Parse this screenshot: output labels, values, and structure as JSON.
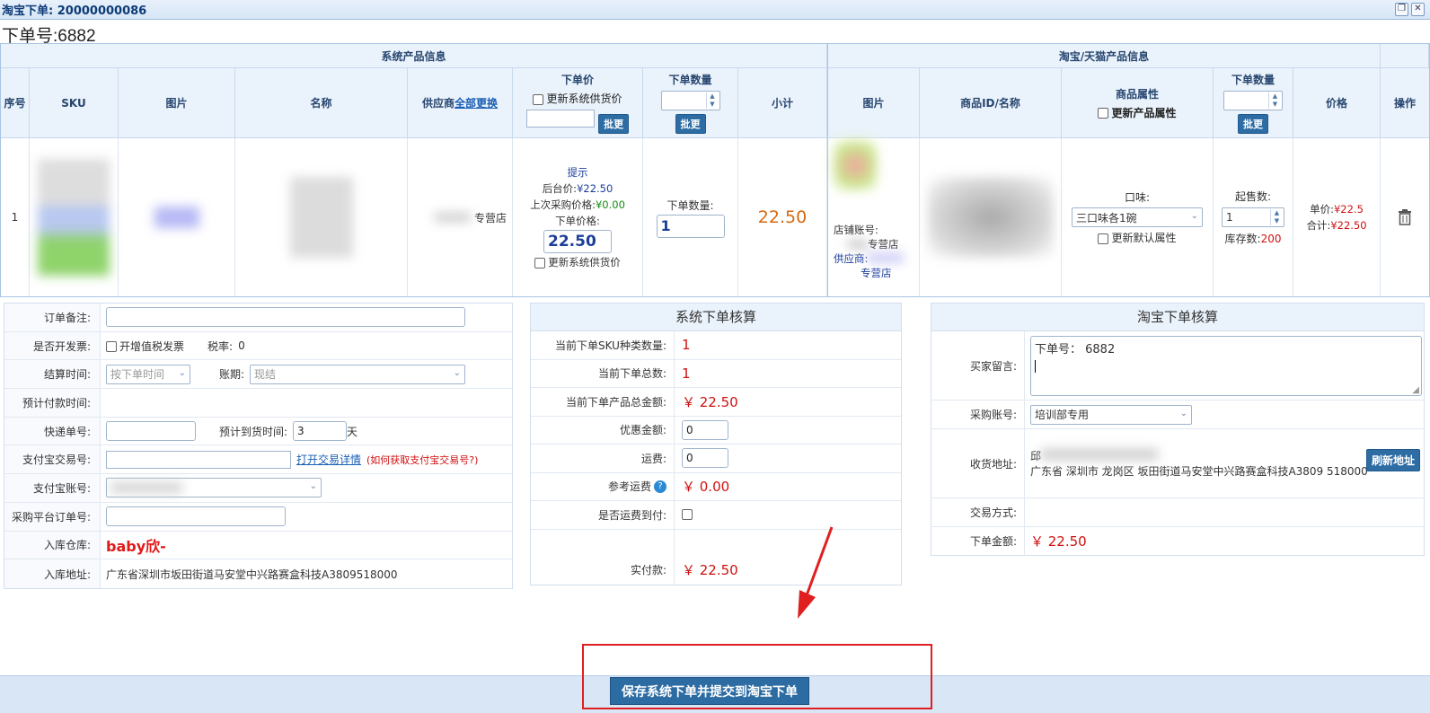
{
  "window": {
    "title": "淘宝下单: 20000000086",
    "order_label": "下单号:6882"
  },
  "header": {
    "sys_group": "系统产品信息",
    "tb_group": "淘宝/天猫产品信息",
    "col_no": "序号",
    "col_sku": "SKU",
    "col_img": "图片",
    "col_name": "名称",
    "col_supplier": "供应商",
    "col_supplier_link": "全部更换",
    "col_price": "下单价",
    "col_price_chk": "更新系统供货价",
    "col_qty": "下单数量",
    "col_subtotal": "小计",
    "col_tb_img": "图片",
    "col_tb_id": "商品ID/名称",
    "col_attr": "商品属性",
    "col_attr_chk": "更新产品属性",
    "col_tb_qty": "下单数量",
    "col_tb_price": "价格",
    "col_op": "操作",
    "batch": "批更"
  },
  "row": {
    "no": "1",
    "supplier": "专营店",
    "hint": "提示",
    "back_price_label": "后台价:",
    "back_price": "¥22.50",
    "last_price_label": "上次采购价格:",
    "last_price": "¥0.00",
    "order_price_label": "下单价格:",
    "order_price": "22.50",
    "update_chk": "更新系统供货价",
    "qty_label": "下单数量:",
    "qty": "1",
    "subtotal": "22.50",
    "shop_label": "店铺账号:",
    "shop_name": "专营店",
    "supplier_label": "供应商:",
    "supplier_name": "专营店",
    "flavor_label": "口味:",
    "flavor": "三口味各1碗",
    "default_attr": "更新默认属性",
    "min_label": "起售数:",
    "min_qty": "1",
    "stock_label": "库存数:",
    "stock": "200",
    "unit_label": "单价:",
    "unit": "¥22.5",
    "total_label": "合计:",
    "total": "¥22.50"
  },
  "left_form": {
    "remark_label": "订单备注:",
    "invoice_label": "是否开发票:",
    "invoice_chk": "开增值税发票",
    "tax_label": "税率:",
    "tax": "0",
    "settle_label": "结算时间:",
    "settle": "按下单时间",
    "period_label": "账期:",
    "period": "现结",
    "pay_time_label": "预计付款时间:",
    "express_label": "快递单号:",
    "arrive_label": "预计到货时间:",
    "arrive": "3",
    "arrive_unit": "天",
    "alipay_trade_label": "支付宝交易号:",
    "open_detail": "打开交易详情",
    "how_get": "(如何获取支付宝交易号?)",
    "alipay_acc_label": "支付宝账号:",
    "platform_label": "采购平台订单号:",
    "warehouse_label": "入库仓库:",
    "warehouse": "baby欣-",
    "wh_addr_label": "入库地址:",
    "wh_addr": "广东省深圳市坂田街道马安堂中兴路赛盒科技A3809518000"
  },
  "mid_form": {
    "title": "系统下单核算",
    "sku_kind_label": "当前下单SKU种类数量:",
    "sku_kind": "1",
    "total_count_label": "当前下单总数:",
    "total_count": "1",
    "amount_label": "当前下单产品总金额:",
    "amount": "￥ 22.50",
    "discount_label": "优惠金额:",
    "discount": "0",
    "freight_label": "运费:",
    "freight": "0",
    "ref_freight_label": "参考运费",
    "ref_freight": "￥ 0.00",
    "cod_label": "是否运费到付:",
    "paid_label": "实付款:",
    "paid": "￥ 22.50"
  },
  "right_form": {
    "title": "淘宝下单核算",
    "buyer_msg_label": "买家留言:",
    "buyer_msg": "下单号： 6882",
    "purchase_acc_label": "采购账号:",
    "purchase_acc": "培训部专用",
    "addr_label": "收货地址:",
    "addr_prefix": "邱",
    "addr": "广东省 深圳市 龙岗区 坂田街道马安堂中兴路赛盒科技A3809 518000",
    "refresh": "刷新地址",
    "trade_label": "交易方式:",
    "amount_label": "下单金额:",
    "amount": "￥ 22.50"
  },
  "footer": {
    "save": "保存系统下单并提交到淘宝下单"
  }
}
